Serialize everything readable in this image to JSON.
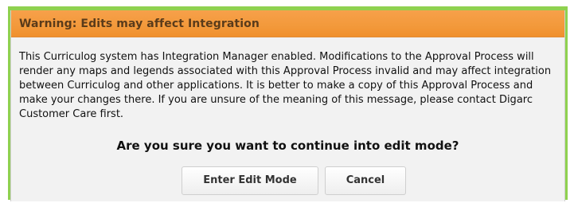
{
  "dialog": {
    "title": "Warning: Edits may affect Integration",
    "body_text": "This Curriculog system has Integration Manager enabled. Modifications to the Approval Process will render any maps and legends associated with this Approval Process invalid and may affect integration between Curriculog and other applications. It is better to make a copy of this Approval Process and make your changes there. If you are unsure of the meaning of this message, please contact Digarc Customer Care first.",
    "question": "Are you sure you want to continue into edit mode?",
    "buttons": {
      "enter_edit_mode": "Enter Edit Mode",
      "cancel": "Cancel"
    }
  },
  "colors": {
    "title_bar": "#f39a3c",
    "border_accent": "#8fd14f",
    "dialog_background": "#f2f2f2"
  }
}
